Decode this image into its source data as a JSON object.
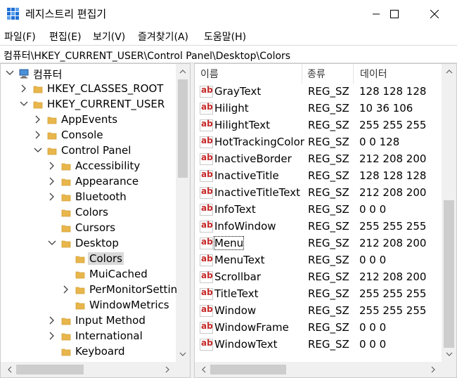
{
  "window": {
    "title": "레지스트리 편집기"
  },
  "menu": [
    "파일(F)",
    "편집(E)",
    "보기(V)",
    "즐겨찾기(A)",
    "도움말(H)"
  ],
  "address": "컴퓨터\\HKEY_CURRENT_USER\\Control Panel\\Desktop\\Colors",
  "tree": [
    {
      "label": "컴퓨터",
      "depth": 0,
      "chev": "down",
      "icon": "computer"
    },
    {
      "label": "HKEY_CLASSES_ROOT",
      "depth": 1,
      "chev": "right",
      "icon": "folder"
    },
    {
      "label": "HKEY_CURRENT_USER",
      "depth": 1,
      "chev": "down",
      "icon": "folder"
    },
    {
      "label": "AppEvents",
      "depth": 2,
      "chev": "right",
      "icon": "folder"
    },
    {
      "label": "Console",
      "depth": 2,
      "chev": "right",
      "icon": "folder"
    },
    {
      "label": "Control Panel",
      "depth": 2,
      "chev": "down",
      "icon": "folder"
    },
    {
      "label": "Accessibility",
      "depth": 3,
      "chev": "right",
      "icon": "folder"
    },
    {
      "label": "Appearance",
      "depth": 3,
      "chev": "right",
      "icon": "folder"
    },
    {
      "label": "Bluetooth",
      "depth": 3,
      "chev": "right",
      "icon": "folder"
    },
    {
      "label": "Colors",
      "depth": 3,
      "chev": "",
      "icon": "folder"
    },
    {
      "label": "Cursors",
      "depth": 3,
      "chev": "",
      "icon": "folder"
    },
    {
      "label": "Desktop",
      "depth": 3,
      "chev": "down",
      "icon": "folder-open"
    },
    {
      "label": "Colors",
      "depth": 4,
      "chev": "",
      "icon": "folder",
      "selected": true
    },
    {
      "label": "MuiCached",
      "depth": 4,
      "chev": "",
      "icon": "folder"
    },
    {
      "label": "PerMonitorSettin",
      "depth": 4,
      "chev": "right",
      "icon": "folder"
    },
    {
      "label": "WindowMetrics",
      "depth": 4,
      "chev": "",
      "icon": "folder"
    },
    {
      "label": "Input Method",
      "depth": 3,
      "chev": "right",
      "icon": "folder"
    },
    {
      "label": "International",
      "depth": 3,
      "chev": "right",
      "icon": "folder"
    },
    {
      "label": "Keyboard",
      "depth": 3,
      "chev": "",
      "icon": "folder"
    }
  ],
  "columns": [
    "이름",
    "종류",
    "데이터"
  ],
  "values": [
    {
      "name": "GrayText",
      "type": "REG_SZ",
      "data": "128 128 128"
    },
    {
      "name": "Hilight",
      "type": "REG_SZ",
      "data": "10 36 106"
    },
    {
      "name": "HilightText",
      "type": "REG_SZ",
      "data": "255 255 255"
    },
    {
      "name": "HotTrackingColor",
      "type": "REG_SZ",
      "data": "0 0 128"
    },
    {
      "name": "InactiveBorder",
      "type": "REG_SZ",
      "data": "212 208 200"
    },
    {
      "name": "InactiveTitle",
      "type": "REG_SZ",
      "data": "128 128 128"
    },
    {
      "name": "InactiveTitleText",
      "type": "REG_SZ",
      "data": "212 208 200"
    },
    {
      "name": "InfoText",
      "type": "REG_SZ",
      "data": "0 0 0"
    },
    {
      "name": "InfoWindow",
      "type": "REG_SZ",
      "data": "255 255 255"
    },
    {
      "name": "Menu",
      "type": "REG_SZ",
      "data": "212 208 200",
      "focused": true
    },
    {
      "name": "MenuText",
      "type": "REG_SZ",
      "data": "0 0 0"
    },
    {
      "name": "Scrollbar",
      "type": "REG_SZ",
      "data": "212 208 200"
    },
    {
      "name": "TitleText",
      "type": "REG_SZ",
      "data": "255 255 255"
    },
    {
      "name": "Window",
      "type": "REG_SZ",
      "data": "255 255 255"
    },
    {
      "name": "WindowFrame",
      "type": "REG_SZ",
      "data": "0 0 0"
    },
    {
      "name": "WindowText",
      "type": "REG_SZ",
      "data": "0 0 0"
    }
  ],
  "colors": {
    "folder": "#e8b64a",
    "folder_dark": "#d4a03a",
    "ab_red": "#c62828",
    "app_blue": "#1f6fd6"
  }
}
